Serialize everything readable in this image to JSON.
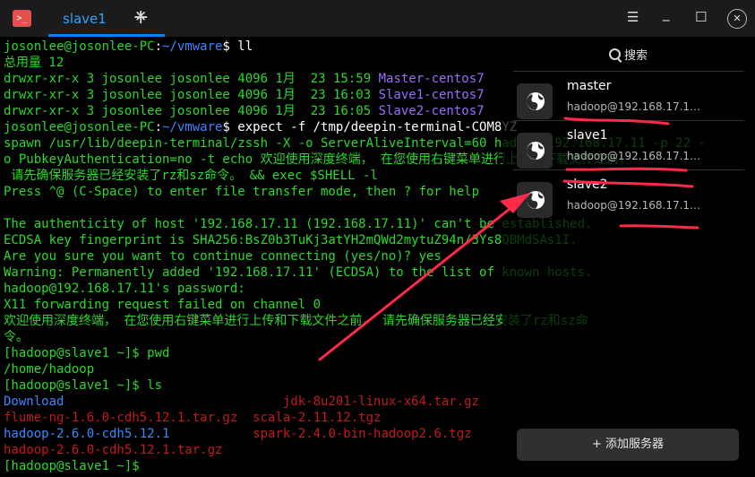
{
  "tab": {
    "label": "slave1"
  },
  "terminal": {
    "lines": [
      [
        [
          "josonlee@josonlee-PC",
          "g"
        ],
        [
          ":",
          "w"
        ],
        [
          "~/vmware",
          "b"
        ],
        [
          "$ ll",
          "w"
        ]
      ],
      [
        [
          "总用量 12",
          "g"
        ]
      ],
      [
        [
          "drwxr-xr-x 3 josonlee josonlee 4096 1月  23 15:59 ",
          "g"
        ],
        [
          "Master-centos7",
          "p"
        ]
      ],
      [
        [
          "drwxr-xr-x 3 josonlee josonlee 4096 1月  23 16:03 ",
          "g"
        ],
        [
          "Slave1-centos7",
          "p"
        ]
      ],
      [
        [
          "drwxr-xr-x 3 josonlee josonlee 4096 1月  23 16:05 ",
          "g"
        ],
        [
          "Slave2-centos7",
          "p"
        ]
      ],
      [
        [
          "josonlee@josonlee-PC",
          "g"
        ],
        [
          ":",
          "w"
        ],
        [
          "~/vmware",
          "b"
        ],
        [
          "$ expect -f /tmp/deepin-terminal-COM8YZ",
          "w"
        ]
      ],
      [
        [
          "spawn /usr/lib/deepin-terminal/zssh -X -o ServerAliveInterval=60 hadoop@192.168.17.11 -p 22 -",
          "g"
        ]
      ],
      [
        [
          "o PubkeyAuthentication=no -t echo 欢迎使用深度终端， 在您使用右键菜单进行上传和下载文件之前，",
          "g"
        ]
      ],
      [
        [
          " 请先确保服务器已经安装了rz和sz命令。 && exec $SHELL -l",
          "g"
        ]
      ],
      [
        [
          "Press ^@ (C-Space) to enter file transfer mode, then ? for help",
          "g"
        ]
      ],
      [
        [
          "",
          "g"
        ]
      ],
      [
        [
          "The authenticity of host '192.168.17.11 (192.168.17.11)' can't be established.",
          "g"
        ]
      ],
      [
        [
          "ECDSA key fingerprint is SHA256:BsZ0b3TuKj3atYH2mQWd2mytuZ94n/3Ys8QBMdSAs1I.",
          "g"
        ]
      ],
      [
        [
          "Are you sure you want to continue connecting (yes/no)? yes",
          "g"
        ]
      ],
      [
        [
          "Warning: Permanently added '192.168.17.11' (ECDSA) to the list of known hosts.",
          "g"
        ]
      ],
      [
        [
          "hadoop@192.168.17.11's password:",
          "g"
        ]
      ],
      [
        [
          "X11 forwarding request failed on channel 0",
          "g"
        ]
      ],
      [
        [
          "欢迎使用深度终端， 在您使用右键菜单进行上传和下载文件之前， 请先确保服务器已经安装了rz和sz命",
          "g"
        ]
      ],
      [
        [
          "令。",
          "g"
        ]
      ],
      [
        [
          "[hadoop@slave1 ~]$ pwd",
          "g"
        ]
      ],
      [
        [
          "/home/hadoop",
          "g"
        ]
      ],
      [
        [
          "[hadoop@slave1 ~]$ ls",
          "g"
        ]
      ],
      [
        [
          "Download",
          "b"
        ],
        [
          "                             ",
          "g"
        ],
        [
          "jdk-8u201-linux-x64.tar.gz",
          "r"
        ]
      ],
      [
        [
          "flume-ng-1.6.0-cdh5.12.1.tar.gz",
          "r"
        ],
        [
          "  ",
          "g"
        ],
        [
          "scala-2.11.12.tgz",
          "r"
        ]
      ],
      [
        [
          "hadoop-2.6.0-cdh5.12.1",
          "b"
        ],
        [
          "           ",
          "g"
        ],
        [
          "spark-2.4.0-bin-hadoop2.6.tgz",
          "r"
        ]
      ],
      [
        [
          "hadoop-2.6.0-cdh5.12.1.tar.gz",
          "r"
        ]
      ],
      [
        [
          "[hadoop@slave1 ~]$ ",
          "g"
        ]
      ]
    ]
  },
  "panel": {
    "search_label": "搜索",
    "servers": [
      {
        "name": "master",
        "address": "hadoop@192.168.17.1…"
      },
      {
        "name": "slave1",
        "address": "hadoop@192.168.17.1…"
      },
      {
        "name": "slave2",
        "address": "hadoop@192.168.17.1…"
      }
    ],
    "add_button_label": "+ 添加服务器"
  },
  "colors": {
    "prompt_green": "#2bd82b",
    "path_blue": "#3a87ff",
    "dir_purple": "#9a6dff",
    "archive_red": "#c21b1b",
    "tab_accent": "#0081ff",
    "annotation_red": "#ff2a4a"
  },
  "icons": {
    "app": "terminal-app-icon",
    "tab_close": "close-icon",
    "new_tab": "plus-icon",
    "menu": "hamburger-menu-icon",
    "minimize": "minimize-icon",
    "maximize": "maximize-icon",
    "close": "close-circle-icon",
    "search": "search-icon",
    "server": "globe-icon"
  }
}
